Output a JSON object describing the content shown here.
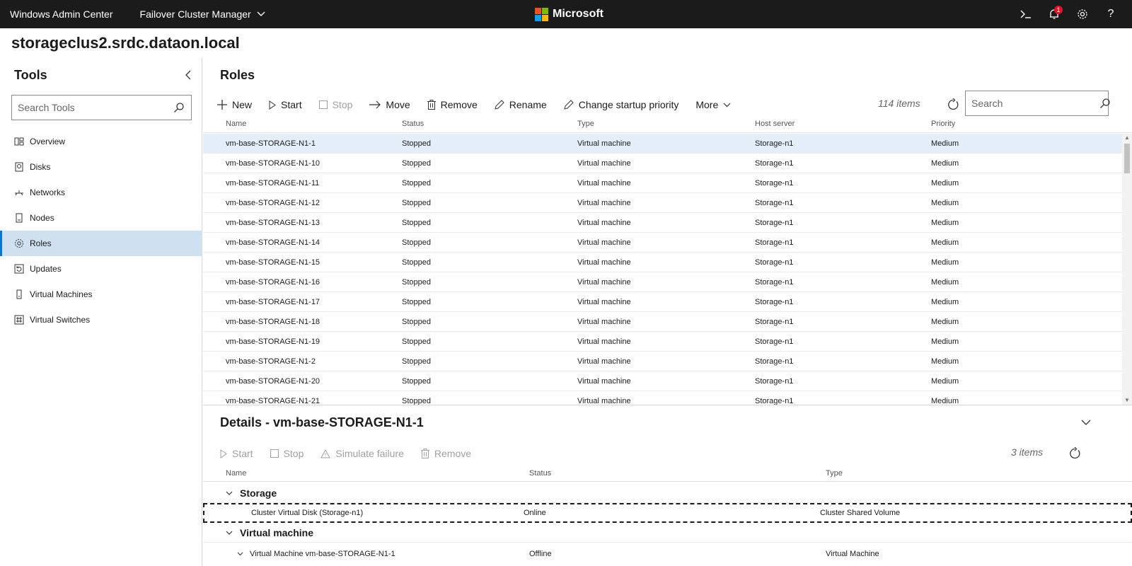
{
  "topbar": {
    "app_name": "Windows Admin Center",
    "tool_switch": "Failover Cluster Manager",
    "brand": "Microsoft",
    "notification_count": "1"
  },
  "connection_title": "storageclus2.srdc.dataon.local",
  "sidebar": {
    "title": "Tools",
    "search_placeholder": "Search Tools",
    "items": [
      {
        "label": "Overview",
        "icon": "overview-icon"
      },
      {
        "label": "Disks",
        "icon": "disk-icon"
      },
      {
        "label": "Networks",
        "icon": "network-icon"
      },
      {
        "label": "Nodes",
        "icon": "node-icon"
      },
      {
        "label": "Roles",
        "icon": "gear-icon",
        "active": true
      },
      {
        "label": "Updates",
        "icon": "updates-icon"
      },
      {
        "label": "Virtual Machines",
        "icon": "virtual-machine-icon"
      },
      {
        "label": "Virtual Switches",
        "icon": "virtual-switch-icon"
      }
    ]
  },
  "roles": {
    "title": "Roles",
    "toolbar": {
      "new": "New",
      "start": "Start",
      "stop": "Stop",
      "move": "Move",
      "remove": "Remove",
      "rename": "Rename",
      "change_priority": "Change startup priority",
      "more": "More"
    },
    "item_count": "114 items",
    "search_placeholder": "Search",
    "columns": {
      "name": "Name",
      "status": "Status",
      "type": "Type",
      "host": "Host server",
      "priority": "Priority"
    },
    "rows": [
      {
        "name": "vm-base-STORAGE-N1-1",
        "status": "Stopped",
        "type": "Virtual machine",
        "host": "Storage-n1",
        "priority": "Medium"
      },
      {
        "name": "vm-base-STORAGE-N1-10",
        "status": "Stopped",
        "type": "Virtual machine",
        "host": "Storage-n1",
        "priority": "Medium"
      },
      {
        "name": "vm-base-STORAGE-N1-11",
        "status": "Stopped",
        "type": "Virtual machine",
        "host": "Storage-n1",
        "priority": "Medium"
      },
      {
        "name": "vm-base-STORAGE-N1-12",
        "status": "Stopped",
        "type": "Virtual machine",
        "host": "Storage-n1",
        "priority": "Medium"
      },
      {
        "name": "vm-base-STORAGE-N1-13",
        "status": "Stopped",
        "type": "Virtual machine",
        "host": "Storage-n1",
        "priority": "Medium"
      },
      {
        "name": "vm-base-STORAGE-N1-14",
        "status": "Stopped",
        "type": "Virtual machine",
        "host": "Storage-n1",
        "priority": "Medium"
      },
      {
        "name": "vm-base-STORAGE-N1-15",
        "status": "Stopped",
        "type": "Virtual machine",
        "host": "Storage-n1",
        "priority": "Medium"
      },
      {
        "name": "vm-base-STORAGE-N1-16",
        "status": "Stopped",
        "type": "Virtual machine",
        "host": "Storage-n1",
        "priority": "Medium"
      },
      {
        "name": "vm-base-STORAGE-N1-17",
        "status": "Stopped",
        "type": "Virtual machine",
        "host": "Storage-n1",
        "priority": "Medium"
      },
      {
        "name": "vm-base-STORAGE-N1-18",
        "status": "Stopped",
        "type": "Virtual machine",
        "host": "Storage-n1",
        "priority": "Medium"
      },
      {
        "name": "vm-base-STORAGE-N1-19",
        "status": "Stopped",
        "type": "Virtual machine",
        "host": "Storage-n1",
        "priority": "Medium"
      },
      {
        "name": "vm-base-STORAGE-N1-2",
        "status": "Stopped",
        "type": "Virtual machine",
        "host": "Storage-n1",
        "priority": "Medium"
      },
      {
        "name": "vm-base-STORAGE-N1-20",
        "status": "Stopped",
        "type": "Virtual machine",
        "host": "Storage-n1",
        "priority": "Medium"
      },
      {
        "name": "vm-base-STORAGE-N1-21",
        "status": "Stopped",
        "type": "Virtual machine",
        "host": "Storage-n1",
        "priority": "Medium"
      }
    ]
  },
  "details": {
    "title": "Details - vm-base-STORAGE-N1-1",
    "toolbar": {
      "start": "Start",
      "stop": "Stop",
      "simulate": "Simulate failure",
      "remove": "Remove"
    },
    "item_count": "3 items",
    "columns": {
      "name": "Name",
      "status": "Status",
      "type": "Type"
    },
    "groups": [
      {
        "label": "Storage",
        "items": [
          {
            "name": "Cluster Virtual Disk (Storage-n1)",
            "status": "Online",
            "type": "Cluster Shared Volume"
          }
        ]
      },
      {
        "label": "Virtual machine",
        "items": [
          {
            "name": "Virtual Machine vm-base-STORAGE-N1-1",
            "status": "Offline",
            "type": "Virtual Machine"
          }
        ]
      }
    ]
  }
}
